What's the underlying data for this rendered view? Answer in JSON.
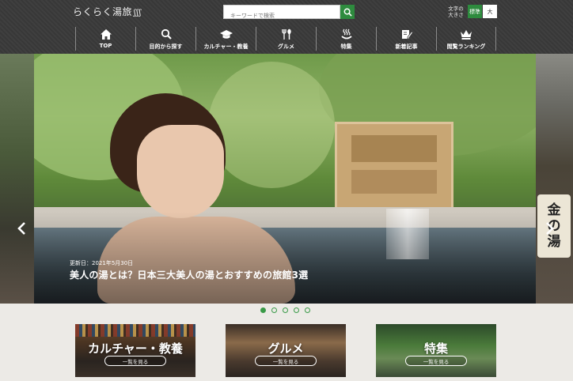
{
  "header": {
    "logo": "らくらく湯旅",
    "search": {
      "placeholder": "キーワードで検索"
    },
    "font_size": {
      "label_line1": "文字の",
      "label_line2": "大きさ",
      "standard": "標準",
      "large": "大"
    },
    "nav": [
      {
        "label": "TOP",
        "icon": "home-icon"
      },
      {
        "label": "目的から探す",
        "icon": "search-icon"
      },
      {
        "label": "カルチャー・教養",
        "icon": "graduation-cap-icon"
      },
      {
        "label": "グルメ",
        "icon": "fork-spoon-icon"
      },
      {
        "label": "特集",
        "icon": "hot-spring-icon"
      },
      {
        "label": "新着記事",
        "icon": "pencil-note-icon"
      },
      {
        "label": "閲覧ランキング",
        "icon": "crown-icon"
      }
    ]
  },
  "hero": {
    "updated": "更新日：2021年5月30日",
    "title": "美人の湯とは？日本三大美人の湯とおすすめの旅館3選",
    "side_sign": [
      "金",
      "の",
      "湯"
    ],
    "active_dot": 0,
    "dot_count": 5
  },
  "categories": [
    {
      "title": "カルチャー・教養",
      "button": "一覧を見る"
    },
    {
      "title": "グルメ",
      "button": "一覧を見る"
    },
    {
      "title": "特集",
      "button": "一覧を見る"
    }
  ],
  "colors": {
    "accent": "#2e8b3e",
    "header_bg": "#3c3c3c",
    "page_bg": "#eceae6"
  }
}
